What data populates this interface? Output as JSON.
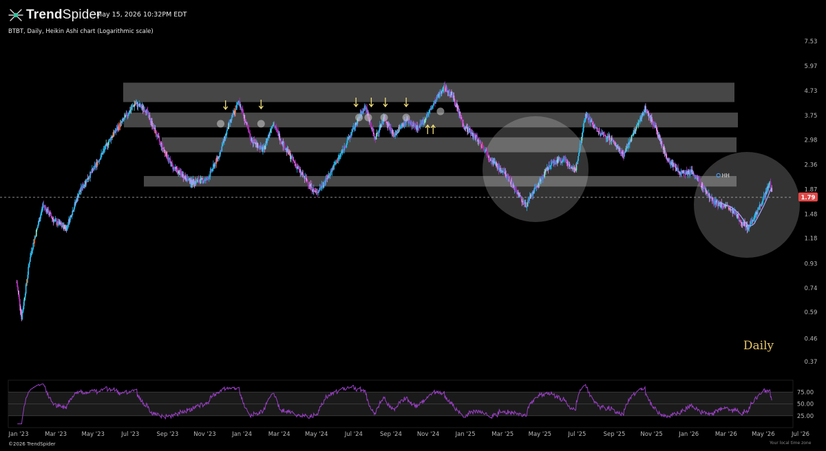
{
  "header": {
    "brand_bold": "Trend",
    "brand_light": "Spider",
    "timestamp": "May 15, 2026 10:32PM EDT",
    "subtitle": "BTBT, Daily, Heikin Ashi chart (Logarithmic scale)"
  },
  "annotation_label": "Daily",
  "footer": {
    "copyright": "©2026 TrendSpider",
    "timezone_note": "Your local time zone"
  },
  "colors": {
    "background": "#000000",
    "bull": "#29b6e8",
    "bull_alt": "#7de2c8",
    "bear": "#b02fb8",
    "bear_light": "#e58ef0",
    "orange": "#e8782a",
    "price_tag": "#e04848",
    "arrow": "#f3e07a",
    "rsi_line": "#9b3fc7",
    "zone_fill": "#5a5a5a"
  },
  "chart_data": [
    {
      "type": "candlestick",
      "title": "BTBT, Daily, Heikin Ashi chart (Logarithmic scale)",
      "y_scale": "log",
      "y_ticks": [
        "7.53",
        "5.97",
        "4.73",
        "3.75",
        "2.98",
        "2.36",
        "1.87",
        "1.48",
        "1.18",
        "0.93",
        "0.74",
        "0.59",
        "0.46",
        "0.37"
      ],
      "x_ticks": [
        "Jan '23",
        "Mar '23",
        "May '23",
        "Jul '23",
        "Sep '23",
        "Nov '23",
        "Jan '24",
        "Mar '24",
        "May '24",
        "Jul '24",
        "Sep '24",
        "Nov '24",
        "Jan '25",
        "Mar '25",
        "May '25",
        "Jul '25",
        "Sep '25",
        "Nov '25",
        "Jan '26",
        "Mar '26",
        "May '26",
        "Jul '26"
      ],
      "last_price": "1.79",
      "price_points": [
        {
          "x": "2022-12-29",
          "y": 0.78
        },
        {
          "x": "2023-01-06",
          "y": 0.56
        },
        {
          "x": "2023-01-20",
          "y": 1.0
        },
        {
          "x": "2023-02-10",
          "y": 1.62
        },
        {
          "x": "2023-03-01",
          "y": 1.38
        },
        {
          "x": "2023-03-20",
          "y": 1.3
        },
        {
          "x": "2023-04-10",
          "y": 1.82
        },
        {
          "x": "2023-05-05",
          "y": 2.3
        },
        {
          "x": "2023-06-01",
          "y": 3.05
        },
        {
          "x": "2023-06-25",
          "y": 3.7
        },
        {
          "x": "2023-07-10",
          "y": 4.2
        },
        {
          "x": "2023-07-28",
          "y": 3.95
        },
        {
          "x": "2023-08-20",
          "y": 2.9
        },
        {
          "x": "2023-09-10",
          "y": 2.3
        },
        {
          "x": "2023-10-10",
          "y": 2.0
        },
        {
          "x": "2023-11-05",
          "y": 2.05
        },
        {
          "x": "2023-11-25",
          "y": 2.6
        },
        {
          "x": "2023-12-10",
          "y": 3.4
        },
        {
          "x": "2023-12-27",
          "y": 4.3
        },
        {
          "x": "2024-01-15",
          "y": 3.0
        },
        {
          "x": "2024-02-05",
          "y": 2.7
        },
        {
          "x": "2024-02-20",
          "y": 3.5
        },
        {
          "x": "2024-03-10",
          "y": 2.8
        },
        {
          "x": "2024-04-05",
          "y": 2.2
        },
        {
          "x": "2024-05-01",
          "y": 1.8
        },
        {
          "x": "2024-05-20",
          "y": 2.1
        },
        {
          "x": "2024-06-10",
          "y": 2.6
        },
        {
          "x": "2024-07-01",
          "y": 3.3
        },
        {
          "x": "2024-07-20",
          "y": 4.1
        },
        {
          "x": "2024-08-05",
          "y": 3.0
        },
        {
          "x": "2024-08-20",
          "y": 3.7
        },
        {
          "x": "2024-09-05",
          "y": 3.1
        },
        {
          "x": "2024-09-25",
          "y": 3.6
        },
        {
          "x": "2024-10-15",
          "y": 3.3
        },
        {
          "x": "2024-11-05",
          "y": 4.0
        },
        {
          "x": "2024-11-25",
          "y": 4.9
        },
        {
          "x": "2024-12-10",
          "y": 4.5
        },
        {
          "x": "2024-12-28",
          "y": 3.4
        },
        {
          "x": "2025-01-20",
          "y": 3.0
        },
        {
          "x": "2025-02-15",
          "y": 2.4
        },
        {
          "x": "2025-03-10",
          "y": 2.1
        },
        {
          "x": "2025-04-08",
          "y": 1.6
        },
        {
          "x": "2025-04-25",
          "y": 1.9
        },
        {
          "x": "2025-05-20",
          "y": 2.4
        },
        {
          "x": "2025-06-10",
          "y": 2.5
        },
        {
          "x": "2025-06-28",
          "y": 2.2
        },
        {
          "x": "2025-07-15",
          "y": 3.8
        },
        {
          "x": "2025-08-05",
          "y": 3.2
        },
        {
          "x": "2025-08-25",
          "y": 3.0
        },
        {
          "x": "2025-09-15",
          "y": 2.6
        },
        {
          "x": "2025-10-05",
          "y": 3.3
        },
        {
          "x": "2025-10-20",
          "y": 4.0
        },
        {
          "x": "2025-11-05",
          "y": 3.4
        },
        {
          "x": "2025-11-25",
          "y": 2.5
        },
        {
          "x": "2025-12-15",
          "y": 2.2
        },
        {
          "x": "2026-01-05",
          "y": 2.2
        },
        {
          "x": "2026-01-20",
          "y": 1.95
        },
        {
          "x": "2026-02-10",
          "y": 1.65
        },
        {
          "x": "2026-03-01",
          "y": 1.6
        },
        {
          "x": "2026-03-20",
          "y": 1.45
        },
        {
          "x": "2026-04-05",
          "y": 1.3
        },
        {
          "x": "2026-04-20",
          "y": 1.5
        },
        {
          "x": "2026-05-05",
          "y": 1.8
        },
        {
          "x": "2026-05-12",
          "y": 2.0
        },
        {
          "x": "2026-05-15",
          "y": 1.79
        }
      ],
      "support_resistance_zones": [
        {
          "low": 4.25,
          "high": 5.1
        },
        {
          "low": 3.35,
          "high": 3.85
        },
        {
          "low": 2.65,
          "high": 3.05
        },
        {
          "low": 1.92,
          "high": 2.12
        }
      ],
      "annotations": [
        "Daily",
        "HH"
      ]
    },
    {
      "type": "line",
      "name": "RSI",
      "y_ticks": [
        "75.00",
        "50.00",
        "25.00"
      ],
      "levels": [
        75,
        50,
        25
      ]
    }
  ]
}
